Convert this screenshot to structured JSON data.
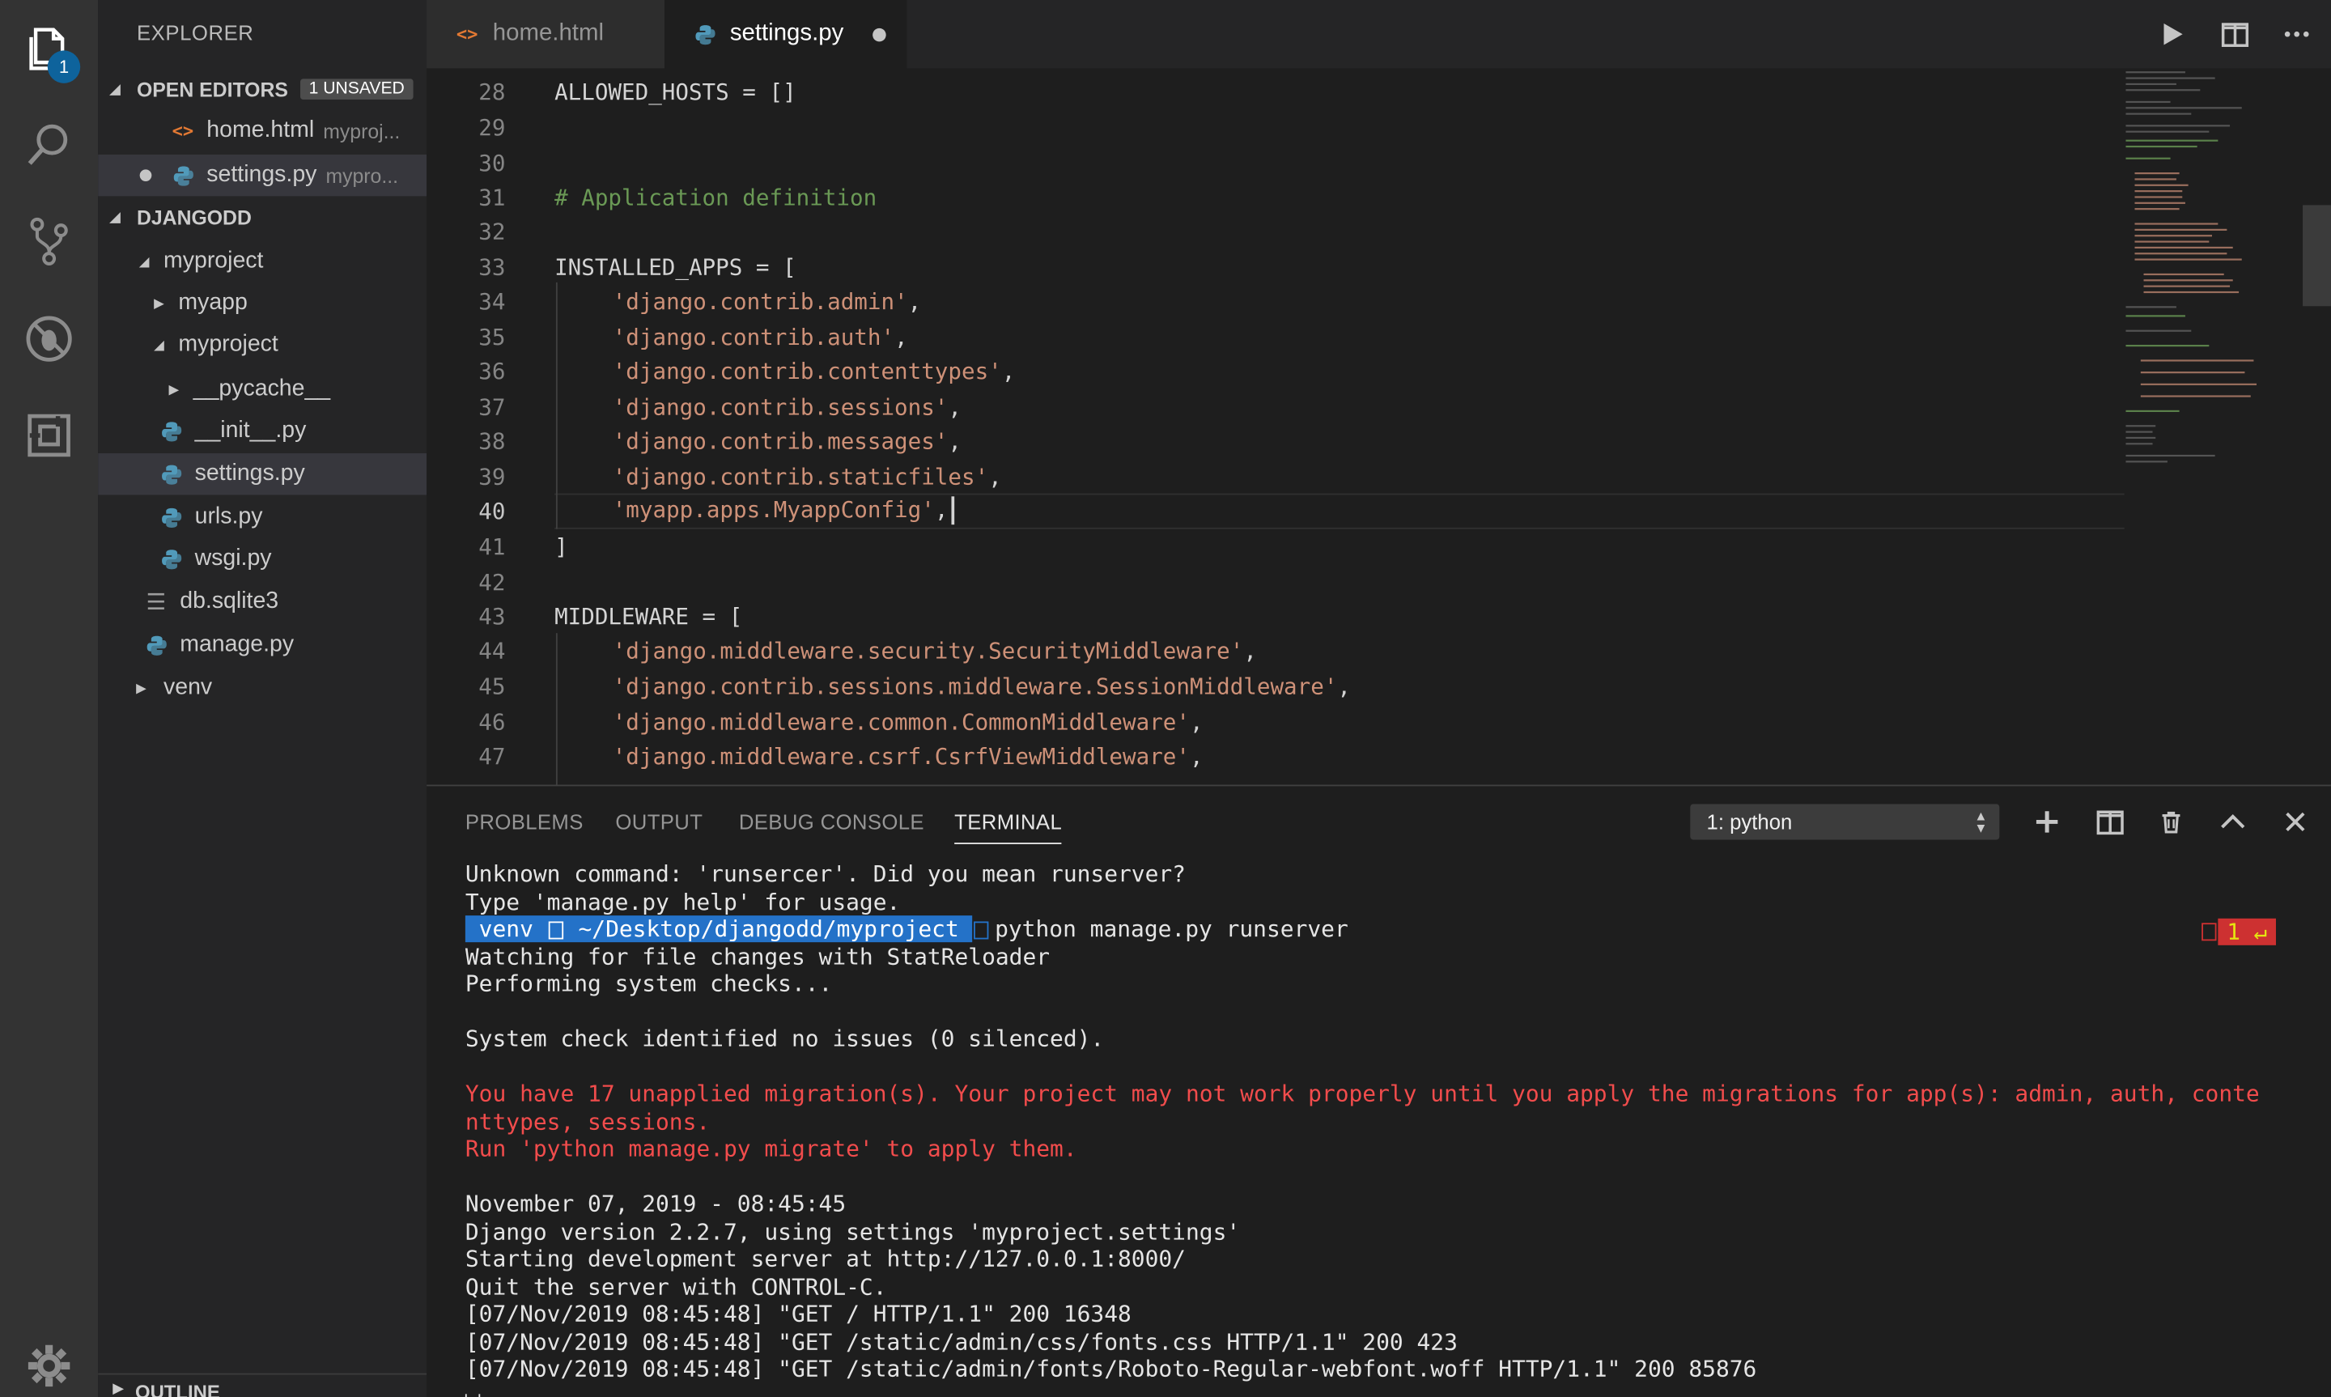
{
  "activity_bar": {
    "explorer_badge": "1",
    "icons": [
      "files-icon",
      "search-icon",
      "source-control-icon",
      "debug-icon",
      "extensions-icon",
      "gear-icon"
    ]
  },
  "sidebar": {
    "title": "EXPLORER",
    "open_editors": {
      "header": "OPEN EDITORS",
      "badge": "1 UNSAVED",
      "items": [
        {
          "label": "home.html",
          "desc": "myproj..."
        },
        {
          "label": "settings.py",
          "desc": "mypro..."
        }
      ]
    },
    "workspace": {
      "header": "DJANGODD",
      "tree": [
        {
          "label": "myproject"
        },
        {
          "label": "myapp"
        },
        {
          "label": "myproject"
        },
        {
          "label": "__pycache__"
        },
        {
          "label": "__init__.py"
        },
        {
          "label": "settings.py"
        },
        {
          "label": "urls.py"
        },
        {
          "label": "wsgi.py"
        },
        {
          "label": "db.sqlite3"
        },
        {
          "label": "manage.py"
        },
        {
          "label": "venv"
        }
      ]
    },
    "outline_header": "OUTLINE"
  },
  "tabs": [
    {
      "label": "home.html"
    },
    {
      "label": "settings.py"
    }
  ],
  "editor": {
    "current_line": "40",
    "lines": [
      {
        "n": "28",
        "code": "ALLOWED_HOSTS = []"
      },
      {
        "n": "29",
        "code": ""
      },
      {
        "n": "30",
        "code": ""
      },
      {
        "n": "31",
        "comment": "# Application definition"
      },
      {
        "n": "32",
        "code": ""
      },
      {
        "n": "33",
        "code": "INSTALLED_APPS = ["
      },
      {
        "n": "34",
        "str": "'django.contrib.admin'",
        "tail": ","
      },
      {
        "n": "35",
        "str": "'django.contrib.auth'",
        "tail": ","
      },
      {
        "n": "36",
        "str": "'django.contrib.contenttypes'",
        "tail": ","
      },
      {
        "n": "37",
        "str": "'django.contrib.sessions'",
        "tail": ","
      },
      {
        "n": "38",
        "str": "'django.contrib.messages'",
        "tail": ","
      },
      {
        "n": "39",
        "str": "'django.contrib.staticfiles'",
        "tail": ","
      },
      {
        "n": "40",
        "str": "'myapp.apps.MyappConfig'",
        "tail": ","
      },
      {
        "n": "41",
        "code": "]"
      },
      {
        "n": "42",
        "code": ""
      },
      {
        "n": "43",
        "code": "MIDDLEWARE = ["
      },
      {
        "n": "44",
        "str": "'django.middleware.security.SecurityMiddleware'",
        "tail": ","
      },
      {
        "n": "45",
        "str": "'django.contrib.sessions.middleware.SessionMiddleware'",
        "tail": ","
      },
      {
        "n": "46",
        "str": "'django.middleware.common.CommonMiddleware'",
        "tail": ","
      },
      {
        "n": "47",
        "str": "'django.middleware.csrf.CsrfViewMiddleware'",
        "tail": ","
      }
    ]
  },
  "panel": {
    "tabs": [
      "PROBLEMS",
      "OUTPUT",
      "DEBUG CONSOLE",
      "TERMINAL"
    ],
    "active_tab": "TERMINAL",
    "terminal_select": "1: python",
    "terminal": {
      "line1": "Unknown command: 'runsercer'. Did you mean runserver?",
      "line2": "Type 'manage.py help' for usage.",
      "prompt_env": " venv ",
      "prompt_path": " ~/Desktop/djangodd/myproject ",
      "command": "python manage.py runserver",
      "right_prompt_code": "1",
      "right_prompt_symbol": "↵",
      "line4": "Watching for file changes with StatReloader",
      "line5": "Performing system checks...",
      "line6": "",
      "line7": "System check identified no issues (0 silenced).",
      "line8": "",
      "line9": "You have 17 unapplied migration(s). Your project may not work properly until you apply the migrations for app(s): admin, auth, conte",
      "line10": "nttypes, sessions.",
      "line11": "Run 'python manage.py migrate' to apply them.",
      "line12": "",
      "line13": "November 07, 2019 - 08:45:45",
      "line14": "Django version 2.2.7, using settings 'myproject.settings'",
      "line15": "Starting development server at http://127.0.0.1:8000/",
      "line16": "Quit the server with CONTROL-C.",
      "line17": "[07/Nov/2019 08:45:48] \"GET / HTTP/1.1\" 200 16348",
      "line18": "[07/Nov/2019 08:45:48] \"GET /static/admin/css/fonts.css HTTP/1.1\" 200 423",
      "line19": "[07/Nov/2019 08:45:48] \"GET /static/admin/fonts/Roboto-Regular-webfont.woff HTTP/1.1\" 200 85876"
    }
  },
  "colors": {
    "activity_bar": "#333333",
    "sidebar": "#252526",
    "editor": "#1e1e1e",
    "string": "#ce9178",
    "comment": "#6a9955",
    "terminal_error": "#f14c4c",
    "badge": "#0e639c"
  }
}
